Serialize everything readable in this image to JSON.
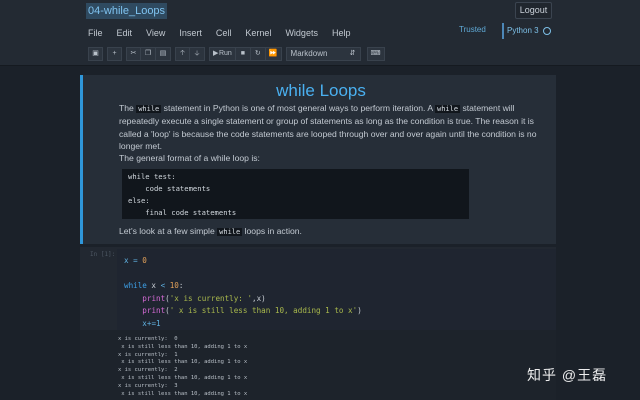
{
  "header": {
    "notebook_name": "04-while_Loops",
    "logout_label": "Logout",
    "trusted_label": "Trusted",
    "kernel_name": "Python 3"
  },
  "menu": [
    "File",
    "Edit",
    "View",
    "Insert",
    "Cell",
    "Kernel",
    "Widgets",
    "Help"
  ],
  "toolbar": {
    "run_label": "Run",
    "cell_type": "Markdown"
  },
  "markdown_cell": {
    "title": "while Loops",
    "p1_a": "The ",
    "p1_code1": "while",
    "p1_b": " statement in Python is one of most general ways to perform iteration. A ",
    "p1_code2": "while",
    "p1_c": " statement will repeatedly execute a single statement or group of statements as long as the condition is true. The reason it is called a 'loop' is because the code statements are looped through over and over again until the condition is no longer met.",
    "p2": "The general format of a while loop is:",
    "pre_lines": [
      "while test:",
      "    code statements",
      "else:",
      "    final code statements"
    ],
    "p3_a": "Let's look at a few simple ",
    "p3_code": "while",
    "p3_b": " loops in action."
  },
  "code_cell": {
    "prompt": "In [1]:",
    "line1_var": "x",
    "line1_op": " = ",
    "line1_num": "0",
    "line2_kw": "while",
    "line2_rest": " x ",
    "line2_op": "<",
    "line2_num": " 10",
    "line2_colon": ":",
    "line3_fn": "print",
    "line3_str": "'x is currently: '",
    "line3_rest": ",x)",
    "line4_fn": "print",
    "line4_str": "' x is still less than 10, adding 1 to x'",
    "line5": "x+=1"
  },
  "output_lines": [
    "x is currently:  0",
    " x is still less than 10, adding 1 to x",
    "x is currently:  1",
    " x is still less than 10, adding 1 to x",
    "x is currently:  2",
    " x is still less than 10, adding 1 to x",
    "x is currently:  3",
    " x is still less than 10, adding 1 to x"
  ],
  "watermark": "知乎 @王磊"
}
